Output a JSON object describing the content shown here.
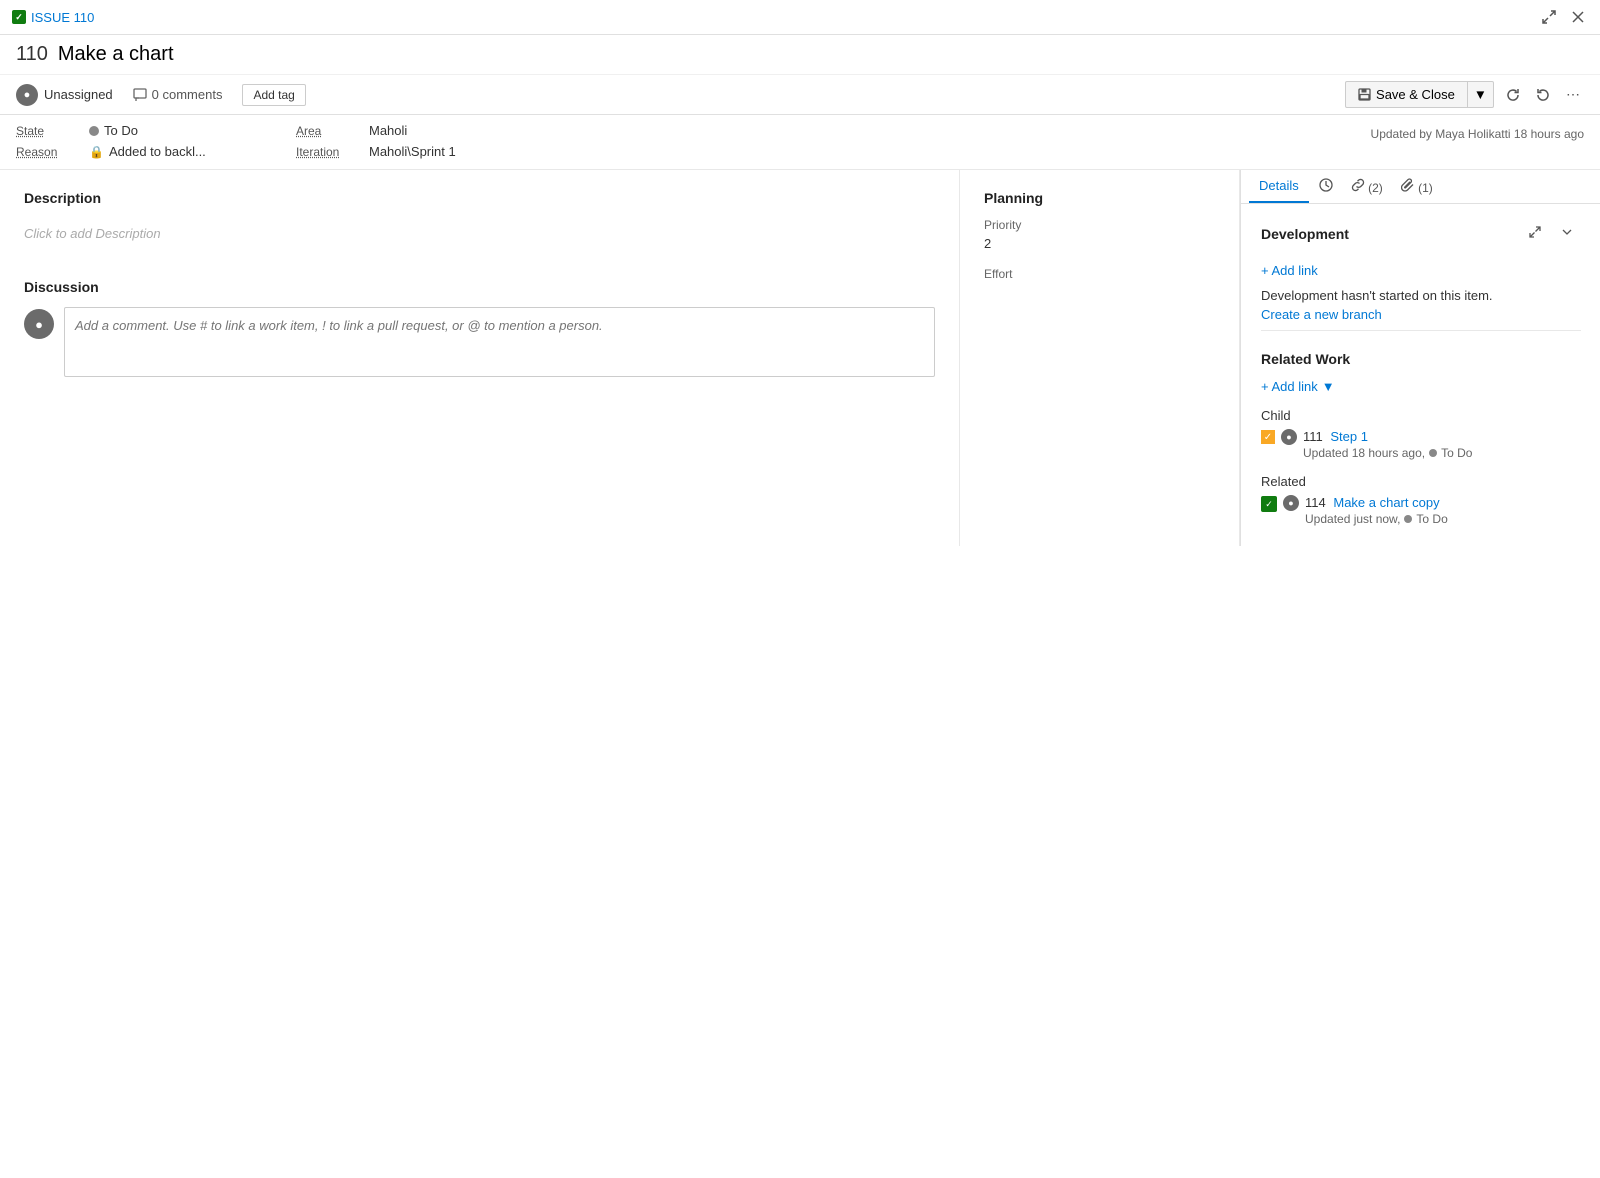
{
  "top_bar": {
    "issue_label": "ISSUE 110",
    "expand_tooltip": "Expand",
    "close_tooltip": "Close"
  },
  "header": {
    "number": "110",
    "title": "Make a chart"
  },
  "meta": {
    "assignee": "Unassigned",
    "comments_count": "0 comments",
    "add_tag_label": "Add tag",
    "save_close_label": "Save & Close",
    "updated_by": "Updated by Maya Holikatti 18 hours ago"
  },
  "fields": {
    "state_label": "State",
    "state_value": "To Do",
    "reason_label": "Reason",
    "reason_value": "Added to backl...",
    "area_label": "Area",
    "area_value": "Maholi",
    "iteration_label": "Iteration",
    "iteration_value": "Maholi\\Sprint 1"
  },
  "tabs": {
    "details_label": "Details",
    "history_tooltip": "History",
    "links_label": "(2)",
    "attachments_label": "(1)"
  },
  "description": {
    "section_title": "Description",
    "placeholder": "Click to add Description"
  },
  "discussion": {
    "section_title": "Discussion",
    "comment_placeholder": "Add a comment. Use # to link a work item, ! to link a pull request, or @ to mention a person."
  },
  "planning": {
    "section_title": "Planning",
    "priority_label": "Priority",
    "priority_value": "2",
    "effort_label": "Effort",
    "effort_value": ""
  },
  "development": {
    "section_title": "Development",
    "add_link_label": "+ Add link",
    "not_started_text": "Development hasn't started on this item.",
    "create_branch_label": "Create a new branch"
  },
  "related_work": {
    "section_title": "Related Work",
    "add_link_label": "+ Add link",
    "child_label": "Child",
    "child_items": [
      {
        "id": "111",
        "title": "Step 1",
        "updated": "Updated 18 hours ago,",
        "status": "To Do"
      }
    ],
    "related_label": "Related",
    "related_items": [
      {
        "id": "114",
        "title": "Make a chart copy",
        "updated": "Updated just now,",
        "status": "To Do"
      }
    ]
  }
}
